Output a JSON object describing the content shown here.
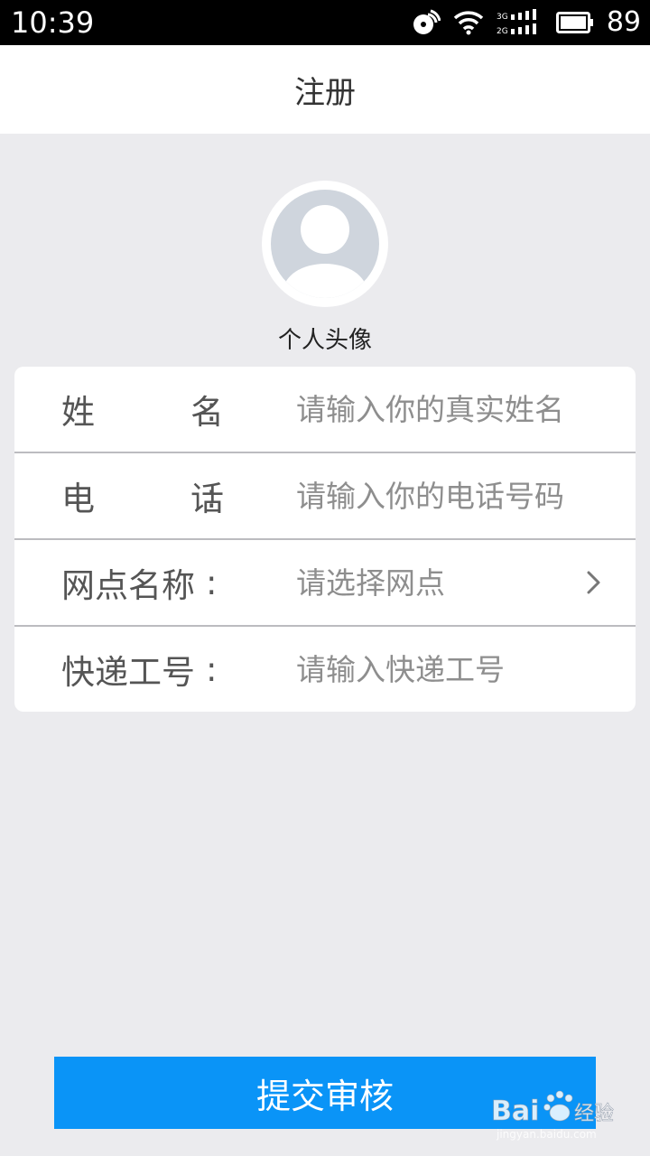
{
  "status_bar": {
    "time": "10:39",
    "battery": "89",
    "icons": [
      "nfc-icon",
      "wifi-icon",
      "signal-3g-2g-icon",
      "battery-icon"
    ]
  },
  "header": {
    "title": "注册"
  },
  "avatar": {
    "label": "个人头像",
    "icon": "user-silhouette-icon"
  },
  "form": {
    "rows": [
      {
        "label_chars": [
          "姓",
          "名"
        ],
        "colon": ":",
        "placeholder": "请输入你的真实姓名",
        "has_chevron": false
      },
      {
        "label_chars": [
          "电",
          "话"
        ],
        "colon": ":",
        "placeholder": "请输入你的电话号码",
        "has_chevron": false
      },
      {
        "label_chars": [
          "网点名称"
        ],
        "colon": ":",
        "placeholder": "请选择网点",
        "has_chevron": true
      },
      {
        "label_chars": [
          "快递工号"
        ],
        "colon": ":",
        "placeholder": "请输入快递工号",
        "has_chevron": false
      }
    ]
  },
  "submit": {
    "label": "提交审核"
  },
  "watermark": {
    "brand": "Bai",
    "suffix": "经验",
    "url": "jingyan.baidu.com"
  },
  "colors": {
    "accent": "#0a94f7",
    "page_background": "#ebebee",
    "placeholder": "#8e8e8e",
    "label": "#555555"
  }
}
